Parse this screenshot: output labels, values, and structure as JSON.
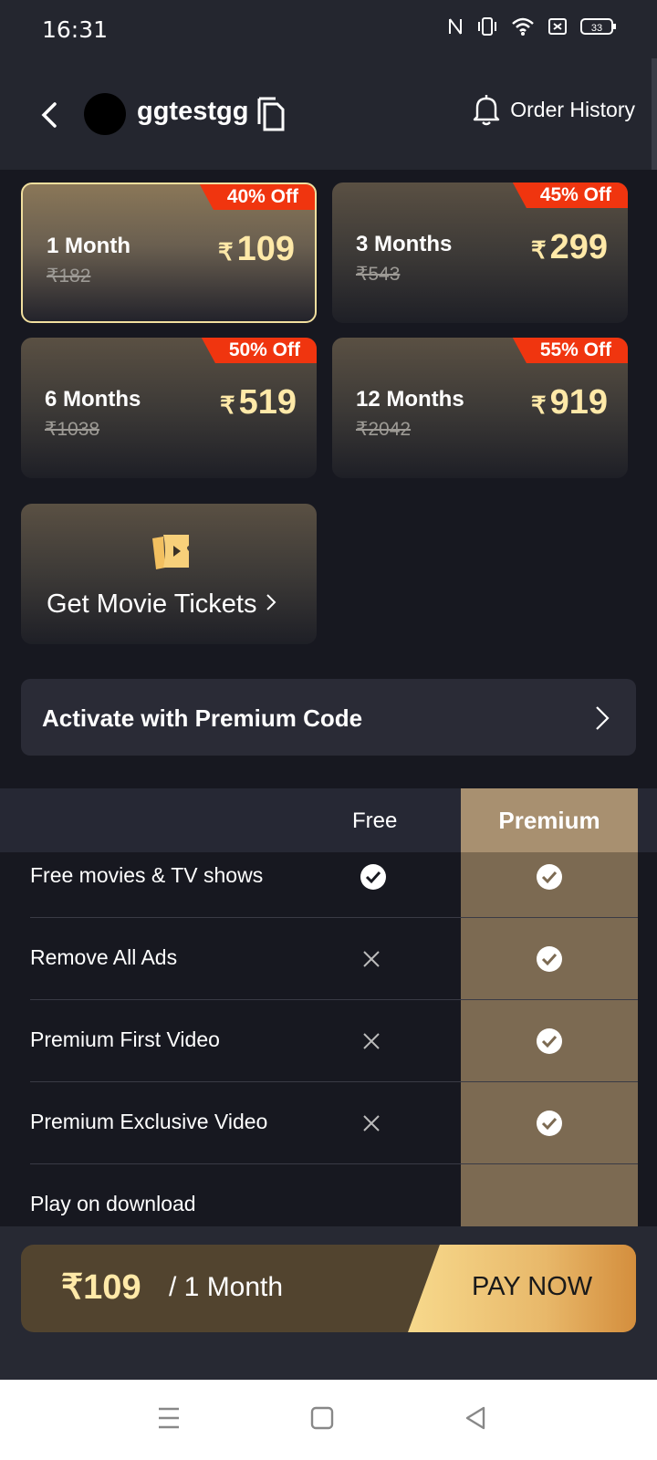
{
  "status": {
    "time": "16:31",
    "battery": "33"
  },
  "header": {
    "username": "ggtestgg",
    "order_history": "Order History"
  },
  "plans": [
    {
      "badge": "40% Off",
      "name": "1 Month",
      "old": "₹182",
      "currency": "₹",
      "price": "109",
      "selected": true
    },
    {
      "badge": "45% Off",
      "name": "3 Months",
      "old": "₹543",
      "currency": "₹",
      "price": "299",
      "selected": false
    },
    {
      "badge": "50% Off",
      "name": "6 Months",
      "old": "₹1038",
      "currency": "₹",
      "price": "519",
      "selected": false
    },
    {
      "badge": "55% Off",
      "name": "12 Months",
      "old": "₹2042",
      "currency": "₹",
      "price": "919",
      "selected": false
    }
  ],
  "tickets": {
    "label": "Get Movie Tickets"
  },
  "promo": {
    "label": "Activate with Premium Code"
  },
  "compare": {
    "col_free": "Free",
    "col_premium": "Premium",
    "rows": [
      {
        "feature": "Free movies & TV shows",
        "free": "check",
        "premium": "check"
      },
      {
        "feature": "Remove All Ads",
        "free": "cross",
        "premium": "check"
      },
      {
        "feature": "Premium First Video",
        "free": "cross",
        "premium": "check"
      },
      {
        "feature": "Premium Exclusive Video",
        "free": "cross",
        "premium": "check"
      },
      {
        "feature": "Play on download",
        "free": "",
        "premium": ""
      }
    ]
  },
  "pay": {
    "amount": "₹109",
    "period": "/ 1 Month",
    "button": "PAY NOW"
  },
  "colors": {
    "accent_gold": "#ffe9a8",
    "badge_red": "#f0350f",
    "premium_col": "#7c6a52",
    "background": "#171820"
  }
}
